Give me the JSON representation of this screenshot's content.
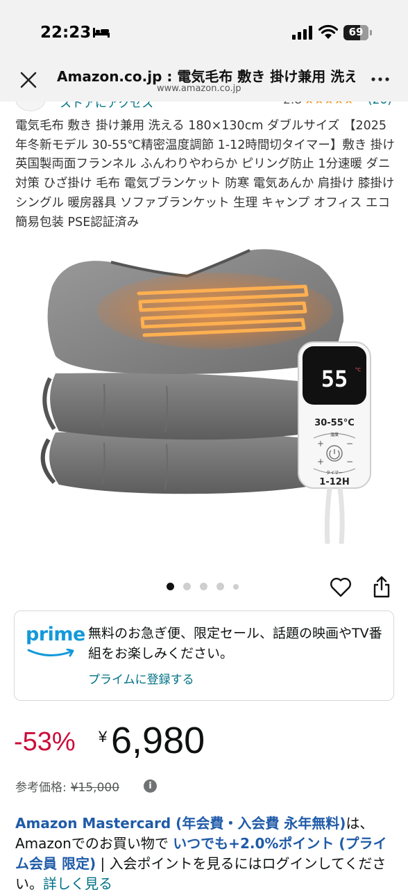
{
  "status_bar": {
    "time": "22:23",
    "battery": "69"
  },
  "browser": {
    "title": "Amazon.co.jp : 電気毛布 敷き 掛け兼用 洗える",
    "url": "www.amazon.co.jp"
  },
  "store": {
    "name": "ストアにアクセス",
    "rating": "2.8",
    "stars": "★★★★★",
    "count": "(20)"
  },
  "product": {
    "title": "電気毛布 敷き 掛け兼用 洗える 180×130cm ダブルサイズ 【2025年冬新モデル 30-55℃精密温度調節 1-12時間切タイマー】敷き 掛け 英国製両面フランネル ふんわりやわらか ピリング防止 1分速暖 ダニ対策 ひざ掛け 毛布 電気ブランケット 防寒 電気あんか 肩掛け 膝掛け シングル 暖房器具 ソファブランケット 生理 キャンプ オフィス エコ簡易包装 PSE認証済み",
    "image": {
      "display_temp": "55",
      "temp_unit": "°C",
      "range_label": "30-55°C",
      "temp_button_label": "温度",
      "timer_button_label": "タイマー",
      "timer_label": "1-12H"
    }
  },
  "carousel": {
    "total": 5,
    "active_index": 0
  },
  "prime": {
    "logo": "prime",
    "text": "無料のお急ぎ便、限定セール、話題の映画やTV番組をお楽しみください。",
    "link": "プライムに登録する"
  },
  "price": {
    "discount": "-53%",
    "currency": "¥",
    "amount": "6,980",
    "ref_label": "参考価格:",
    "ref_value": "¥15,000",
    "info_icon": "i"
  },
  "card_promo": {
    "link": "Amazon Mastercard (年会費・入会費 永年無料)",
    "text1": "は、Amazonでのお買い物で ",
    "bold": "いつでも+2.0%ポイント (プライム会員 限定)",
    "sep": " | ",
    "text2": "入会ポイントを見るにはログインしてください。",
    "link2": "詳しく見る"
  }
}
